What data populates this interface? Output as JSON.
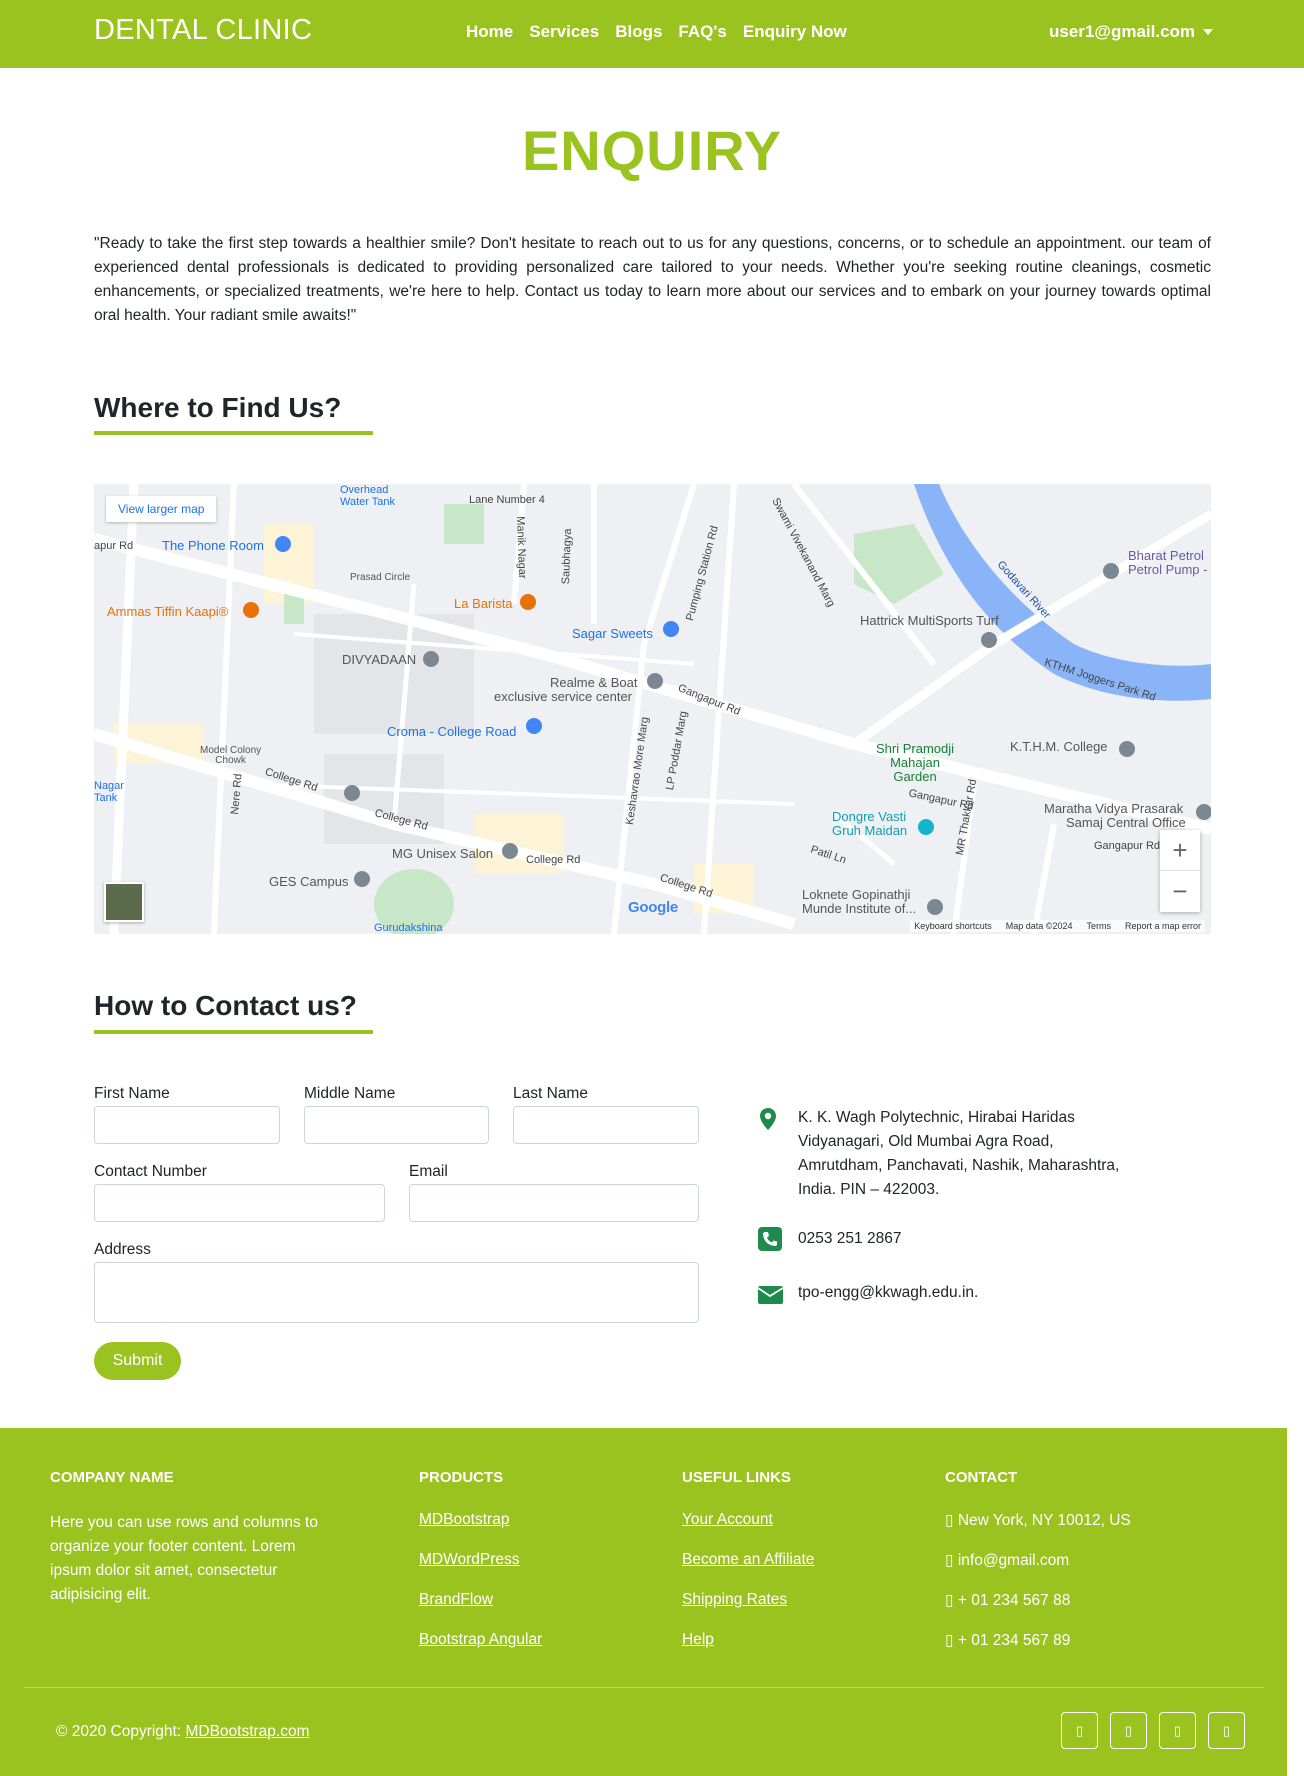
{
  "navbar": {
    "brand": "DENTAL CLINIC",
    "links": [
      "Home",
      "Services",
      "Blogs",
      "FAQ's",
      "Enquiry Now"
    ],
    "user": "user1@gmail.com"
  },
  "page": {
    "title": "ENQUIRY",
    "intro": "\"Ready to take the first step towards a healthier smile? Don't hesitate to reach out to us for any questions, concerns, or to schedule an appointment. our team of experienced dental professionals is dedicated to providing personalized care tailored to your needs. Whether you're seeking routine cleanings, cosmetic enhancements, or specialized treatments, we're here to help. Contact us today to learn more about our services and to embark on your journey towards optimal oral health. Your radiant smile awaits!\""
  },
  "map_section": {
    "title": "Where to Find Us?",
    "view_larger": "View larger map",
    "labels": {
      "overhead": "Overhead\nWater Tank",
      "lane": "Lane Number 4",
      "manik": "Manik Nagar",
      "saubhagya": "Saubhagya",
      "phone_room": "The Phone Room",
      "prasad": "Prasad Circle",
      "la_barista": "La Barista",
      "ammas": "Ammas Tiffin Kaapi®",
      "sagar": "Sagar Sweets",
      "pumping": "Pumping Station Rd",
      "swami": "Swami Vivekanand Marg",
      "divyadaan": "DIVYADAAN",
      "realme": "Realme & Boat",
      "realme2": "exclusive service center",
      "croma": "Croma - College Road",
      "gangapur": "Gangapur Rd",
      "hattrick": "Hattrick MultiSports Turf",
      "godavari": "Godavari River",
      "kthm_jogger": "KTHM Joggers Park Rd",
      "bharat": "Bharat Petrol",
      "bharat2": "Petrol Pump -",
      "model_colony": "Model Colony\nChowk",
      "college_rd": "College Rd",
      "nagar_tank": "Nagar\nTank",
      "nere_rd": "Nere Rd",
      "keshavrao": "Keshavrao More Marg",
      "lp_poddar": "LP Poddar Marg",
      "shri": "Shri Pramodji\nMahajan\nGarden",
      "kthm": "K.T.H.M. College",
      "maratha": "Maratha Vidya Prasarak",
      "maratha2": "Samaj Central Office",
      "mg_unisex": "MG Unisex Salon",
      "ges": "GES Campus",
      "dongre": "Dongre Vasti\nGruh Maidan",
      "patil": "Patil Ln",
      "loknete": "Loknete Gopinathji\nMunde Institute of...",
      "mr_thakkar": "MR Thakkar Rd",
      "gurudakshina": "Gurudakshina",
      "apur_rd": "apur Rd",
      "google": "Google"
    },
    "footer": [
      "Keyboard shortcuts",
      "Map data ©2024",
      "Terms",
      "Report a map error"
    ]
  },
  "contact_section": {
    "title": "How to Contact us?",
    "fields": {
      "first_name": "First Name",
      "middle_name": "Middle Name",
      "last_name": "Last Name",
      "contact_number": "Contact Number",
      "email": "Email",
      "address": "Address"
    },
    "submit": "Submit",
    "address_lines": [
      "K. K. Wagh Polytechnic, Hirabai Haridas",
      "Vidyanagari, Old Mumbai Agra Road,",
      "Amrutdham, Panchavati, Nashik, Maharashtra,",
      "India. PIN – 422003."
    ],
    "phone": "0253 251 2867",
    "email": "tpo-engg@kkwagh.edu.in.",
    "colors": {
      "icon": "#1e8a4c"
    }
  },
  "footer": {
    "company_title": "COMPANY NAME",
    "company_text": "Here you can use rows and columns to organize your footer content. Lorem ipsum dolor sit amet, consectetur adipisicing elit.",
    "products_title": "PRODUCTS",
    "products": [
      "MDBootstrap",
      "MDWordPress",
      "BrandFlow",
      "Bootstrap Angular"
    ],
    "useful_title": "USEFUL LINKS",
    "useful": [
      "Your Account",
      "Become an Affiliate",
      "Shipping Rates",
      "Help"
    ],
    "contact_title": "CONTACT",
    "contact": [
      "▯ New York, NY 10012, US",
      "▯ info@gmail.com",
      "▯ + 01 234 567 88",
      "▯ + 01 234 567 89"
    ],
    "copyright_prefix": "© 2020 Copyright: ",
    "copyright_link": "MDBootstrap.com",
    "social": [
      "▯",
      "▯",
      "▯",
      "▯"
    ]
  },
  "colors": {
    "brand": "#9ac31f",
    "map_bg": "#eef0f3",
    "water": "#8ab4f8"
  }
}
